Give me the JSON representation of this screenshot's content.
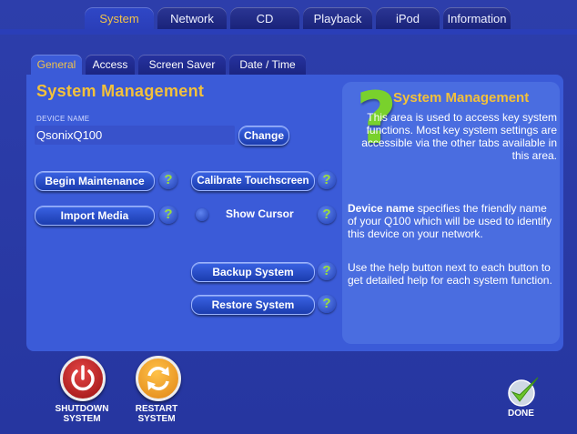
{
  "top_tabs": [
    "System",
    "Network",
    "CD",
    "Playback",
    "iPod",
    "Information"
  ],
  "sub_tabs": [
    "General",
    "Access",
    "Screen Saver",
    "Date / Time"
  ],
  "title": "System Management",
  "device": {
    "label": "DEVICE NAME",
    "value": "QsonixQ100",
    "change_label": "Change"
  },
  "buttons": {
    "begin_maintenance": "Begin Maintenance",
    "import_media": "Import Media",
    "calibrate": "Calibrate Touchscreen",
    "show_cursor": "Show Cursor",
    "backup": "Backup System",
    "restore": "Restore System"
  },
  "help_symbol": "?",
  "info": {
    "icon": "?",
    "title": "System Management",
    "p1": "This area is used to access key system functions. Most key system settings are accessible via the other tabs available in this area.",
    "p2_bold": "Device name",
    "p2_rest": " specifies the friendly name of your Q100 which will be used to identify this device on your network.",
    "p3": "Use the help button next to each button to get detailed help for each system function."
  },
  "footer": {
    "shutdown_l1": "SHUTDOWN",
    "shutdown_l2": "SYSTEM",
    "restart_l1": "RESTART",
    "restart_l2": "SYSTEM",
    "done": "DONE"
  },
  "colors": {
    "background": "#2a3aa6",
    "panel": "#3b5bd8",
    "accent": "#f3c13b",
    "help_green": "#79d12c"
  }
}
